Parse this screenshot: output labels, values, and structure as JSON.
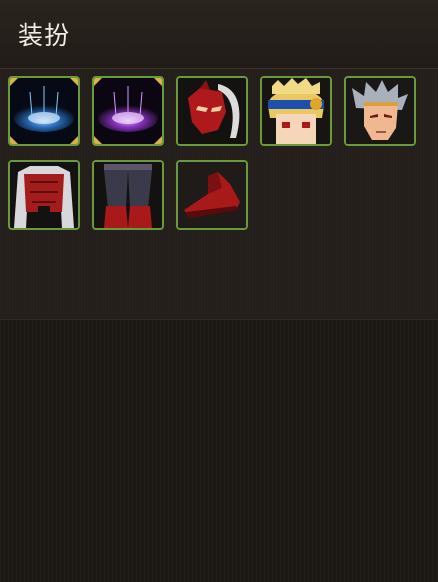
{
  "window": {
    "title": "装扮"
  },
  "slots": [
    {
      "icon": "blue-aura-icon",
      "color": "#2f7fd8"
    },
    {
      "icon": "purple-aura-icon",
      "color": "#9a3ad8"
    },
    {
      "icon": "red-mask-icon",
      "color": "#b0191b"
    },
    {
      "icon": "blonde-hair-headband-icon",
      "color": "#e8c860"
    },
    {
      "icon": "silver-hair-icon",
      "color": "#a8b0bc"
    },
    {
      "icon": "red-coat-icon",
      "color": "#a51c1c"
    },
    {
      "icon": "dark-pants-icon",
      "color": "#3b3a4a"
    },
    {
      "icon": "red-shoes-icon",
      "color": "#a81a1a"
    }
  ],
  "colors": {
    "slot_border": "#6a9a3c",
    "header_bg": "#2a241e",
    "panel_bg": "#1c1814"
  }
}
